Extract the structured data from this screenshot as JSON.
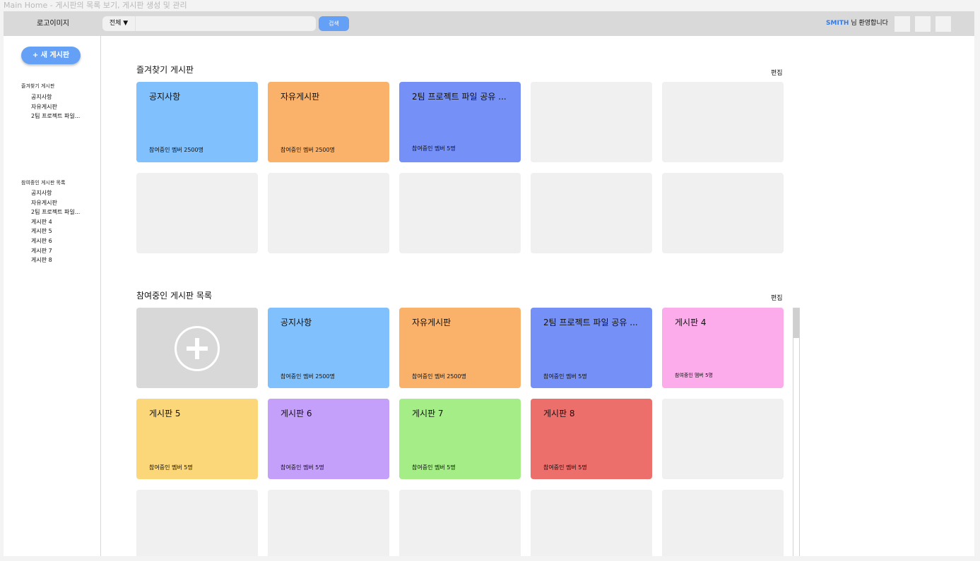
{
  "page_caption": "Main Home - 게시판의 목록 보기, 게시판 생성 및 관리",
  "header": {
    "logo": "로고이미지",
    "search": {
      "scope": "전체 ▼",
      "placeholder": "",
      "button": "검색"
    },
    "welcome": {
      "user": "SMITH",
      "suffix": "님  환영합니다"
    }
  },
  "sidebar": {
    "new_board": "+ 새 게시판",
    "favorites": {
      "title": "즐겨찾기 게시판",
      "items": [
        "공지사항",
        "자유게시판",
        "2팀 프로젝트 파일..."
      ]
    },
    "joined": {
      "title": "참여중인 게시판 목록",
      "items": [
        "공지사항",
        "자유게시판",
        "2팀 프로젝트 파일...",
        "게시판 4",
        "게시판 5",
        "게시판 6",
        "게시판 7",
        "게시판 8"
      ]
    }
  },
  "favorites_section": {
    "title": "즐겨찾기 게시판",
    "edit": "편집",
    "cards": [
      {
        "title": "공지사항",
        "members": "참여중인 멤버 2500명",
        "color": "#80c0fc"
      },
      {
        "title": "자유게시판",
        "members": "참여중인 멤버 2500명",
        "color": "#fab26b"
      },
      {
        "title": "2팀 프로젝트 파일 공유 ...",
        "members": "참여중인 멤버 5명",
        "color": "#7591f8"
      }
    ]
  },
  "joined_section": {
    "title": "참여중인 게시판 목록",
    "edit": "편집",
    "cards": [
      {
        "title": "공지사항",
        "members": "참여중인 멤버 2500명",
        "color": "#80c0fc"
      },
      {
        "title": "자유게시판",
        "members": "참여중인 멤버 2500명",
        "color": "#fab26b"
      },
      {
        "title": "2팀 프로젝트 파일 공유 ...",
        "members": "참여중인 멤버 5명",
        "color": "#7591f8"
      },
      {
        "title": "게시판 4",
        "members": "참여중인 멤버 5명",
        "color": "#fcaceb"
      },
      {
        "title": "게시판 5",
        "members": "참여중인 멤버 5명",
        "color": "#fbd779"
      },
      {
        "title": "게시판 6",
        "members": "참여중인 멤버 5명",
        "color": "#c4a0fb"
      },
      {
        "title": "게시판 7",
        "members": "참여중인 멤버 5명",
        "color": "#a5ed87"
      },
      {
        "title": "게시판 8",
        "members": "참여중인 멤버 5명",
        "color": "#ec6f6c"
      }
    ]
  }
}
